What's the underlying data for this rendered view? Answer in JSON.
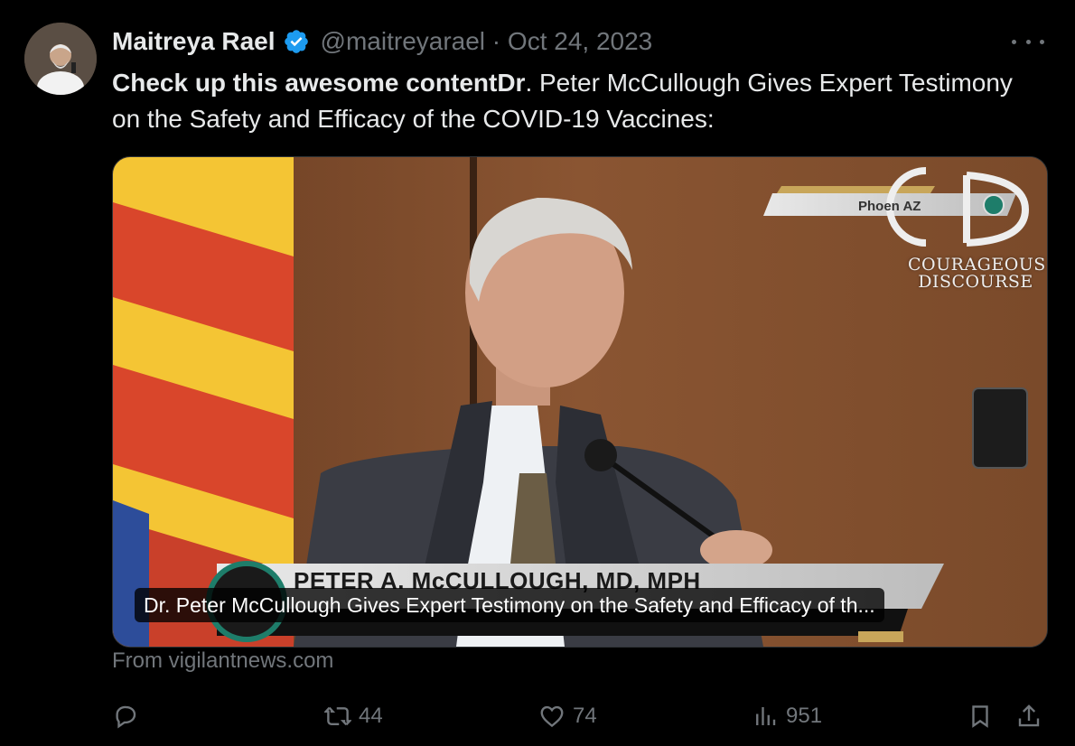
{
  "tweet": {
    "author_name": "Maitreya Rael",
    "handle_date": "@maitreyarael · Oct 24, 2023",
    "text_bold": "Check up this awesome contentDr",
    "text_rest": ". Peter McCullough Gives Expert Testimony on the Safety and Efficacy of the COVID-19 Vaccines:",
    "source": "From vigilantnews.com"
  },
  "media": {
    "caption": "Dr. Peter McCullough Gives Expert Testimony on the Safety and Efficacy of th...",
    "lower_third_name": "PETER A. McCULLOUGH, MD, MPH",
    "location": "Phoen   AZ",
    "logo_line1": "COURAGEOUS",
    "logo_line2": "DISCOURSE"
  },
  "actions": {
    "reply_count": "",
    "retweet_count": "44",
    "like_count": "74",
    "view_count": "951"
  },
  "icons": {
    "reply": "reply-icon",
    "retweet": "retweet-icon",
    "like": "heart-icon",
    "views": "views-icon",
    "bookmark": "bookmark-icon",
    "share": "share-icon",
    "verified": "verified-badge-icon",
    "more": "more-icon"
  },
  "colors": {
    "background": "#000000",
    "text": "#e7e9ea",
    "muted": "#71767b",
    "verified": "#1d9bf0"
  }
}
